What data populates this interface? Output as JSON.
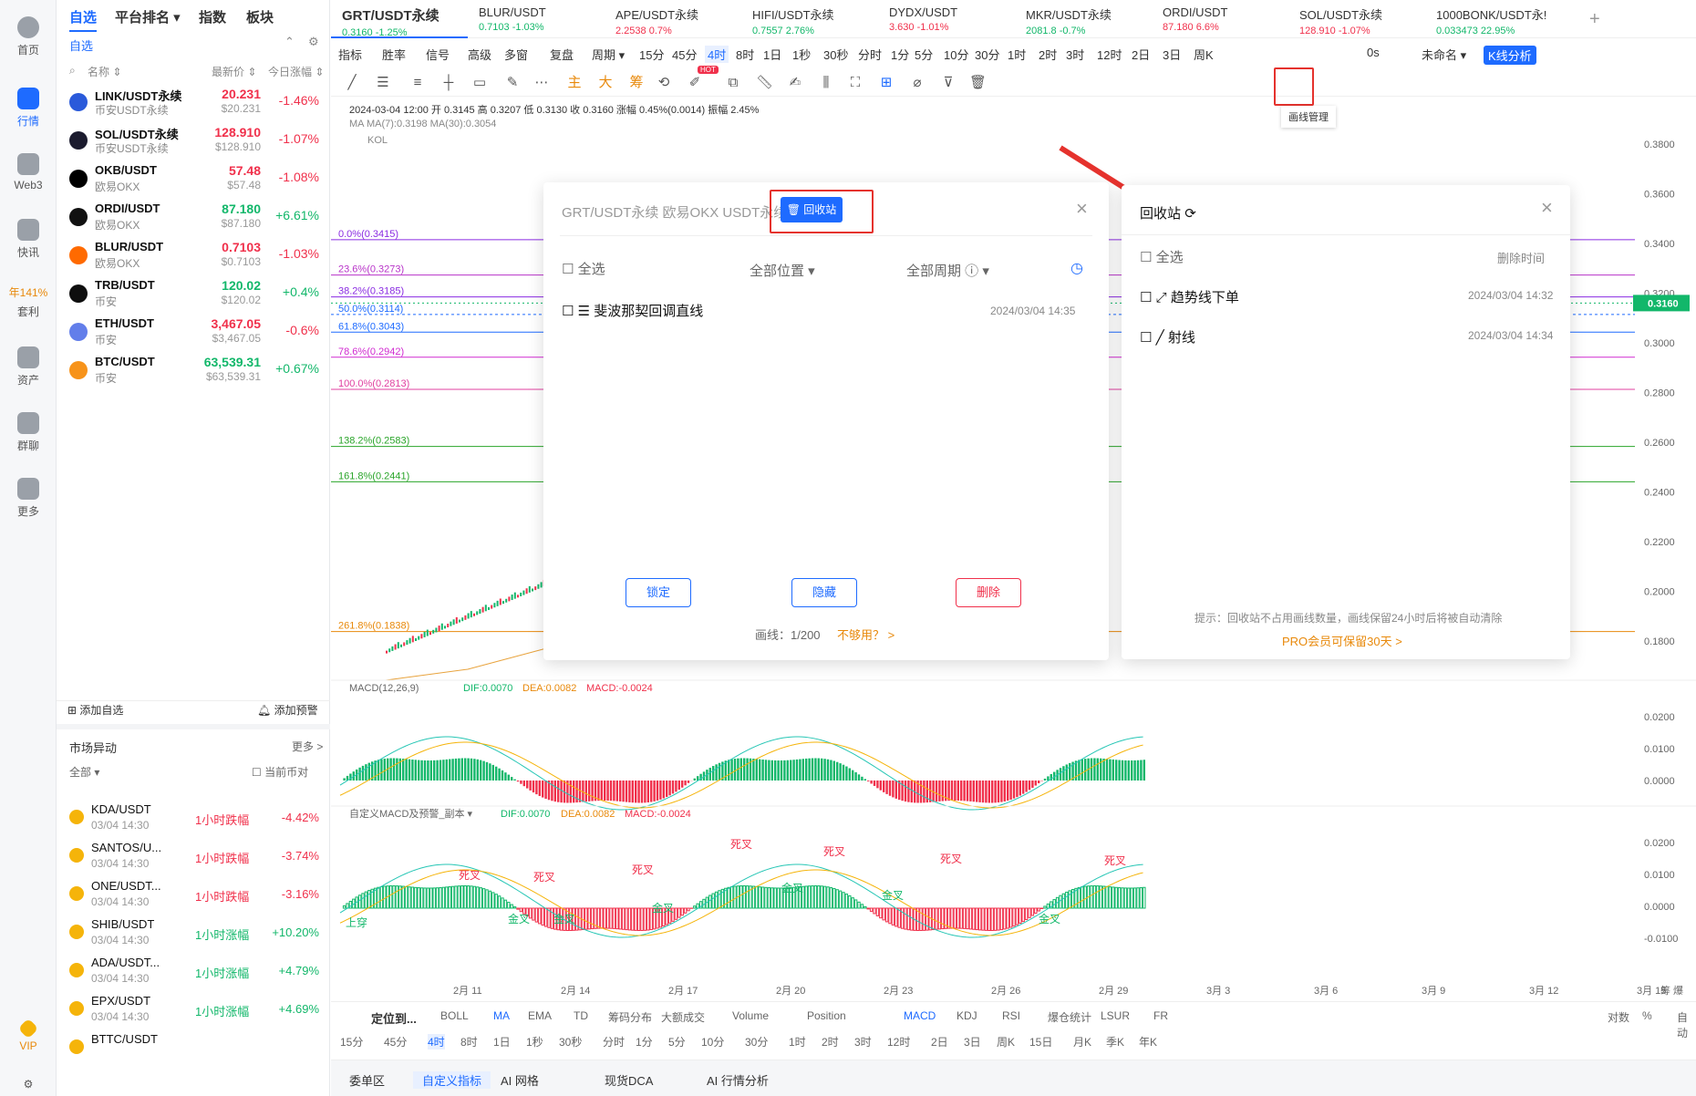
{
  "nav": [
    {
      "label": "首页"
    },
    {
      "label": "行情"
    },
    {
      "label": "Web3"
    },
    {
      "label": "快讯"
    },
    {
      "label": "年141%"
    },
    {
      "label": "套利"
    },
    {
      "label": "资产"
    },
    {
      "label": "群聊"
    },
    {
      "label": "更多"
    },
    {
      "label": "VIP"
    }
  ],
  "watch": {
    "tabs": [
      "自选",
      "平台排名 ▾",
      "指数",
      "板块"
    ],
    "group": "自选",
    "cols": [
      "名称 ⇕",
      "最新价 ⇕",
      "今日涨幅 ⇕"
    ],
    "rows": [
      {
        "sym": "LINK/USDT永续",
        "sub": "币安USDT永续",
        "price": "20.231",
        "price2": "$20.231",
        "chg": "-1.46%",
        "dir": "red",
        "color": "#2a5ada"
      },
      {
        "sym": "SOL/USDT永续",
        "sub": "币安USDT永续",
        "price": "128.910",
        "price2": "$128.910",
        "chg": "-1.07%",
        "dir": "red",
        "color": "#1b1b2e"
      },
      {
        "sym": "OKB/USDT",
        "sub": "欧易OKX",
        "price": "57.48",
        "price2": "$57.48",
        "chg": "-1.08%",
        "dir": "red",
        "color": "#000"
      },
      {
        "sym": "ORDI/USDT",
        "sub": "欧易OKX",
        "price": "87.180",
        "price2": "$87.180",
        "chg": "+6.61%",
        "dir": "green",
        "color": "#111"
      },
      {
        "sym": "BLUR/USDT",
        "sub": "欧易OKX",
        "price": "0.7103",
        "price2": "$0.7103",
        "chg": "-1.03%",
        "dir": "red",
        "color": "#ff6a00"
      },
      {
        "sym": "TRB/USDT",
        "sub": "币安",
        "price": "120.02",
        "price2": "$120.02",
        "chg": "+0.4%",
        "dir": "green",
        "color": "#0e0e0e"
      },
      {
        "sym": "ETH/USDT",
        "sub": "币安",
        "price": "3,467.05",
        "price2": "$3,467.05",
        "chg": "-0.6%",
        "dir": "red",
        "color": "#627eea"
      },
      {
        "sym": "BTC/USDT",
        "sub": "币安",
        "price": "63,539.31",
        "price2": "$63,539.31",
        "chg": "+0.67%",
        "dir": "green",
        "color": "#f7931a"
      }
    ],
    "add_fav": "添加自选",
    "add_alert": "添加预警",
    "market_title": "市场异动",
    "market_more": "更多 >",
    "market_filter": "全部 ▾",
    "market_current": "当前币对",
    "market": [
      {
        "sym": "KDA/USDT",
        "time": "03/04 14:30",
        "tag": "1小时跌幅",
        "chg": "-4.42%",
        "dir": "red"
      },
      {
        "sym": "SANTOS/U...",
        "time": "03/04 14:30",
        "tag": "1小时跌幅",
        "chg": "-3.74%",
        "dir": "red"
      },
      {
        "sym": "ONE/USDT...",
        "time": "03/04 14:30",
        "tag": "1小时跌幅",
        "chg": "-3.16%",
        "dir": "red"
      },
      {
        "sym": "SHIB/USDT",
        "time": "03/04 14:30",
        "tag": "1小时涨幅",
        "chg": "+10.20%",
        "dir": "green"
      },
      {
        "sym": "ADA/USDT...",
        "time": "03/04 14:30",
        "tag": "1小时涨幅",
        "chg": "+4.79%",
        "dir": "green"
      },
      {
        "sym": "EPX/USDT",
        "time": "03/04 14:30",
        "tag": "1小时涨幅",
        "chg": "+4.69%",
        "dir": "green"
      },
      {
        "sym": "BTTC/USDT",
        "time": "",
        "tag": "",
        "chg": "",
        "dir": "green"
      }
    ]
  },
  "tabs": [
    {
      "name": "GRT/USDT永续",
      "val": "0.3160  -1.25%",
      "dir": "green"
    },
    {
      "name": "BLUR/USDT",
      "val": "0.7103  -1.03%",
      "dir": "green"
    },
    {
      "name": "APE/USDT永续",
      "val": "2.2538  0.7%",
      "dir": "red"
    },
    {
      "name": "HIFI/USDT永续",
      "val": "0.7557  2.76%",
      "dir": "green"
    },
    {
      "name": "DYDX/USDT",
      "val": "3.630  -1.01%",
      "dir": "red"
    },
    {
      "name": "MKR/USDT永续",
      "val": "2081.8  -0.7%",
      "dir": "green"
    },
    {
      "name": "ORDI/USDT",
      "val": "87.180  6.6%",
      "dir": "red"
    },
    {
      "name": "SOL/USDT永续",
      "val": "128.910  -1.07%",
      "dir": "red"
    },
    {
      "name": "1000BONK/USDT永!",
      "val": "0.033473  22.95%",
      "dir": "green"
    }
  ],
  "toolbar1": [
    "指标",
    "胜率",
    "信号",
    "高级",
    "多窗",
    "复盘",
    "周期 ▾",
    "15分",
    "45分",
    "4时",
    "8时",
    "1日",
    "1秒",
    "30秒",
    "分时",
    "1分",
    "5分",
    "10分",
    "30分",
    "1时",
    "2时",
    "3时",
    "12时",
    "2日",
    "3日",
    "周K",
    "0s",
    "未命名 ▾",
    "K线分析"
  ],
  "toolbar2": {
    "main": "主",
    "big": "大",
    "chou": "筹",
    "hot": "HOT",
    "tooltip": "画线管理"
  },
  "info": {
    "line": "2024-03-04 12:00  开 0.3145  高 0.3207  低 0.3130  收 0.3160  涨幅 0.45%(0.0014)  振幅 2.45%",
    "ma": "MA  MA(7):0.3198  MA(30):0.3054",
    "kol": "KOL"
  },
  "fib": [
    {
      "label": "0.0%(0.3415)",
      "color": "#8a2be2"
    },
    {
      "label": "23.6%(0.3273)",
      "color": "#b833c9"
    },
    {
      "label": "38.2%(0.3185)",
      "color": "#8a2be2"
    },
    {
      "label": "50.0%(0.3114)",
      "color": "#1e6bff"
    },
    {
      "label": "61.8%(0.3043)",
      "color": "#1e6bff"
    },
    {
      "label": "78.6%(0.2942)",
      "color": "#d12bd1"
    },
    {
      "label": "100.0%(0.2813)",
      "color": "#e040a0"
    },
    {
      "label": "138.2%(0.2583)",
      "color": "#2aa52a"
    },
    {
      "label": "161.8%(0.2441)",
      "color": "#2aa52a"
    },
    {
      "label": "261.8%(0.1838)",
      "color": "#e8890b"
    }
  ],
  "yaxis": [
    "0.3800",
    "0.3600",
    "0.3400",
    "0.3200",
    "0.3000",
    "0.2800",
    "0.2600",
    "0.2400",
    "0.2200",
    "0.2000",
    "0.1800"
  ],
  "price_tag": "0.3160",
  "macd": {
    "label": "MACD(12,26,9)",
    "dif": "DIF:0.0070",
    "dea": "DEA:0.0082",
    "macd": "MACD:-0.0024",
    "y": [
      "0.0200",
      "0.0100",
      "0.0000"
    ]
  },
  "macd2": {
    "label": "自定义MACD及预警_副本 ▾",
    "dif": "DIF:0.0070",
    "dea": "DEA:0.0082",
    "macd": "MACD:-0.0024",
    "y": [
      "0.0200",
      "0.0100",
      "0.0000",
      "-0.0100"
    ],
    "marks": [
      {
        "t": "死叉",
        "c": "red"
      },
      {
        "t": "死叉",
        "c": "red"
      },
      {
        "t": "死叉",
        "c": "red"
      },
      {
        "t": "死叉",
        "c": "red"
      },
      {
        "t": "死叉",
        "c": "red"
      },
      {
        "t": "死叉",
        "c": "red"
      },
      {
        "t": "死叉",
        "c": "red"
      },
      {
        "t": "金叉",
        "c": "green"
      },
      {
        "t": "金叉",
        "c": "green"
      },
      {
        "t": "金叉",
        "c": "green"
      },
      {
        "t": "金叉",
        "c": "green"
      },
      {
        "t": "金叉",
        "c": "green"
      },
      {
        "t": "金叉",
        "c": "green"
      },
      {
        "t": "上穿",
        "c": "green"
      }
    ]
  },
  "xaxis": [
    "2月 11",
    "2月 14",
    "2月 17",
    "2月 20",
    "2月 23",
    "2月 26",
    "2月 29",
    "3月 3",
    "3月 6",
    "3月 9",
    "3月 12",
    "3月 15"
  ],
  "xaxis_extra": "筹  爆",
  "bottombar": {
    "locate": "定位到...",
    "ind": [
      "BOLL",
      "MA",
      "EMA",
      "TD",
      "筹码分布",
      "大额成交",
      "Volume",
      "Position",
      "MACD",
      "KDJ",
      "RSI",
      "爆仓统计",
      "LSUR",
      "FR"
    ],
    "right": [
      "对数",
      "%",
      "自动"
    ],
    "periods": [
      "15分",
      "45分",
      "4时",
      "8时",
      "1日",
      "1秒",
      "30秒",
      "分时",
      "1分",
      "5分",
      "10分",
      "30分",
      "1时",
      "2时",
      "3时",
      "12时",
      "2日",
      "3日",
      "周K",
      "15日",
      "月K",
      "季K",
      "年K"
    ],
    "tabs": [
      "委单区",
      "自定义指标",
      "AI 网格",
      "现货DCA",
      "AI 行情分析"
    ]
  },
  "dlg1": {
    "title": "GRT/USDT永续 欧易OKX USDT永续",
    "recycle": "回收站",
    "all": "全选",
    "pos": "全部位置 ▾",
    "period": "全部周期",
    "item": "斐波那契回调直线",
    "item_time": "2024/03/04 14:35",
    "lock": "锁定",
    "hide": "隐藏",
    "del": "删除",
    "count": "画线：1/200",
    "need": "不够用？ >"
  },
  "dlg2": {
    "title": "回收站",
    "all": "全选",
    "deltime": "删除时间",
    "items": [
      {
        "name": "趋势线下单",
        "time": "2024/03/04 14:32"
      },
      {
        "name": "射线",
        "time": "2024/03/04 14:34"
      }
    ],
    "tip": "提示：回收站不占用画线数量，画线保留24小时后将被自动清除",
    "pro": "PRO会员可保留30天 >"
  }
}
